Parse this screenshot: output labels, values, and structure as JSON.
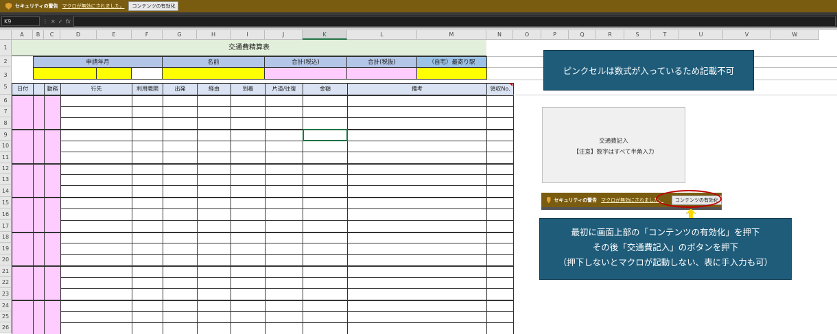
{
  "security_bar": {
    "title": "セキュリティの警告",
    "message": "マクロが無効にされました。",
    "button": "コンテンツの有効化"
  },
  "formula_bar": {
    "name_box": "K9",
    "cancel_icon": "✕",
    "enter_icon": "✓",
    "fx": "fx",
    "content": ""
  },
  "columns": [
    "A",
    "B",
    "C",
    "D",
    "E",
    "F",
    "G",
    "H",
    "I",
    "J",
    "K",
    "L",
    "M",
    "N",
    "O",
    "P",
    "Q",
    "R",
    "S",
    "T",
    "U",
    "V",
    "W"
  ],
  "selected_column": "K",
  "rows": [
    "1",
    "2",
    "3",
    "5",
    "6",
    "7",
    "8",
    "9",
    "10",
    "11",
    "12",
    "13",
    "14",
    "15",
    "16",
    "17",
    "18",
    "19",
    "20",
    "21",
    "22",
    "23",
    "24",
    "25",
    "26"
  ],
  "sheet": {
    "title": "交通費精算表",
    "h_year_month": "申請年月",
    "h_name": "名前",
    "h_total_incl": "合計(税込)",
    "h_total_excl": "合計(税抜)",
    "h_station": "（自宅）最寄り駅",
    "cols": [
      "日付",
      "勤務",
      "行先",
      "利用職関",
      "出発",
      "経由",
      "到着",
      "片道/往復",
      "金額",
      "備考",
      "領収No."
    ]
  },
  "note_pink": "ピンクセルは数式が入っているため記載不可",
  "macro_button": {
    "line1": "交通費記入",
    "line2": "【注意】数字はすべて半角入力"
  },
  "instruction": {
    "line1": "最初に画面上部の「コンテンツの有効化」を押下",
    "line2": "その後「交通費記入」のボタンを押下",
    "line3": "（押下しないとマクロが起動しない、表に手入力も可）"
  },
  "colors": {
    "security": "#7a5c10",
    "title_fill": "#e2efda",
    "header_blue": "#b4c6e7",
    "header_light": "#dae3f3",
    "yellow": "#ffff00",
    "pink": "#ffccff",
    "info_box": "#1f5c7a",
    "oval": "#c00000"
  }
}
